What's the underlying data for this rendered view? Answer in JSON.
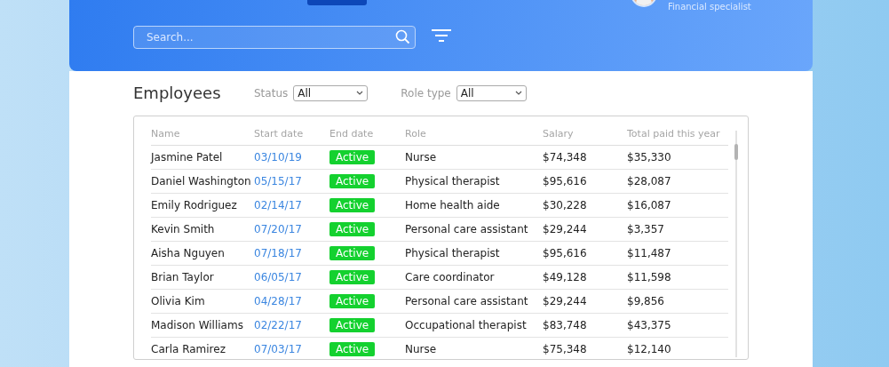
{
  "header": {
    "user_role": "Financial specialist",
    "search": {
      "placeholder": "Search..."
    }
  },
  "employees": {
    "title": "Employees",
    "filters": [
      {
        "label": "Status",
        "value": "All"
      },
      {
        "label": "Role type",
        "value": "All"
      }
    ],
    "table": {
      "columns": [
        "Name",
        "Start date",
        "End date",
        "Role",
        "Salary",
        "Total paid this year"
      ],
      "rows": [
        {
          "name": "Jasmine Patel",
          "start": "03/10/19",
          "end": "Active",
          "role": "Nurse",
          "salary": "$74,348",
          "total": "$35,330"
        },
        {
          "name": "Daniel Washington",
          "start": "05/15/17",
          "end": "Active",
          "role": "Physical therapist",
          "salary": "$95,616",
          "total": "$28,087"
        },
        {
          "name": "Emily Rodriguez",
          "start": "02/14/17",
          "end": "Active",
          "role": "Home health aide",
          "salary": "$30,228",
          "total": "$16,087"
        },
        {
          "name": "Kevin Smith",
          "start": "07/20/17",
          "end": "Active",
          "role": "Personal care assistant",
          "salary": "$29,244",
          "total": "$3,357"
        },
        {
          "name": "Aisha Nguyen",
          "start": "07/18/17",
          "end": "Active",
          "role": "Physical therapist",
          "salary": "$95,616",
          "total": "$11,487"
        },
        {
          "name": "Brian Taylor",
          "start": "06/05/17",
          "end": "Active",
          "role": "Care coordinator",
          "salary": "$49,128",
          "total": "$11,598"
        },
        {
          "name": "Olivia Kim",
          "start": "04/28/17",
          "end": "Active",
          "role": "Personal care assistant",
          "salary": "$29,244",
          "total": "$9,856"
        },
        {
          "name": "Madison Williams",
          "start": "02/22/17",
          "end": "Active",
          "role": "Occupational therapist",
          "salary": "$83,748",
          "total": "$43,375"
        },
        {
          "name": "Carla Ramirez",
          "start": "07/03/17",
          "end": "Active",
          "role": "Nurse",
          "salary": "$75,348",
          "total": "$12,140"
        }
      ]
    }
  }
}
